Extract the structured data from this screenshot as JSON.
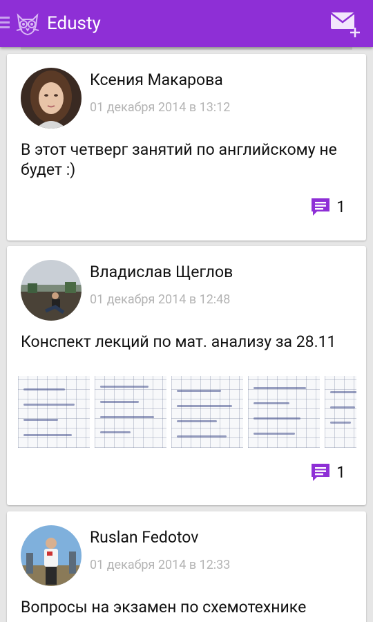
{
  "appbar": {
    "title": "Edusty"
  },
  "posts": [
    {
      "author": "Ксения Макарова",
      "date": "01 декабря 2014 в 13:12",
      "text": "В этот четверг занятий по английскому не будет :)",
      "comments": "1"
    },
    {
      "author": "Владислав Щеглов",
      "date": "01 декабря 2014 в 12:48",
      "text": "Конспект лекций по мат. анализу за 28.11",
      "comments": "1",
      "attachments": 5
    },
    {
      "author": "Ruslan Fedotov",
      "date": "01 декабря 2014 в 12:33",
      "text": "Вопросы на экзамен по схемотехнике"
    }
  ],
  "colors": {
    "primary": "#8e2fd6",
    "comment_icon": "#8e2fd6",
    "background": "#e6e6e6",
    "date_text": "#b4b4b4"
  }
}
